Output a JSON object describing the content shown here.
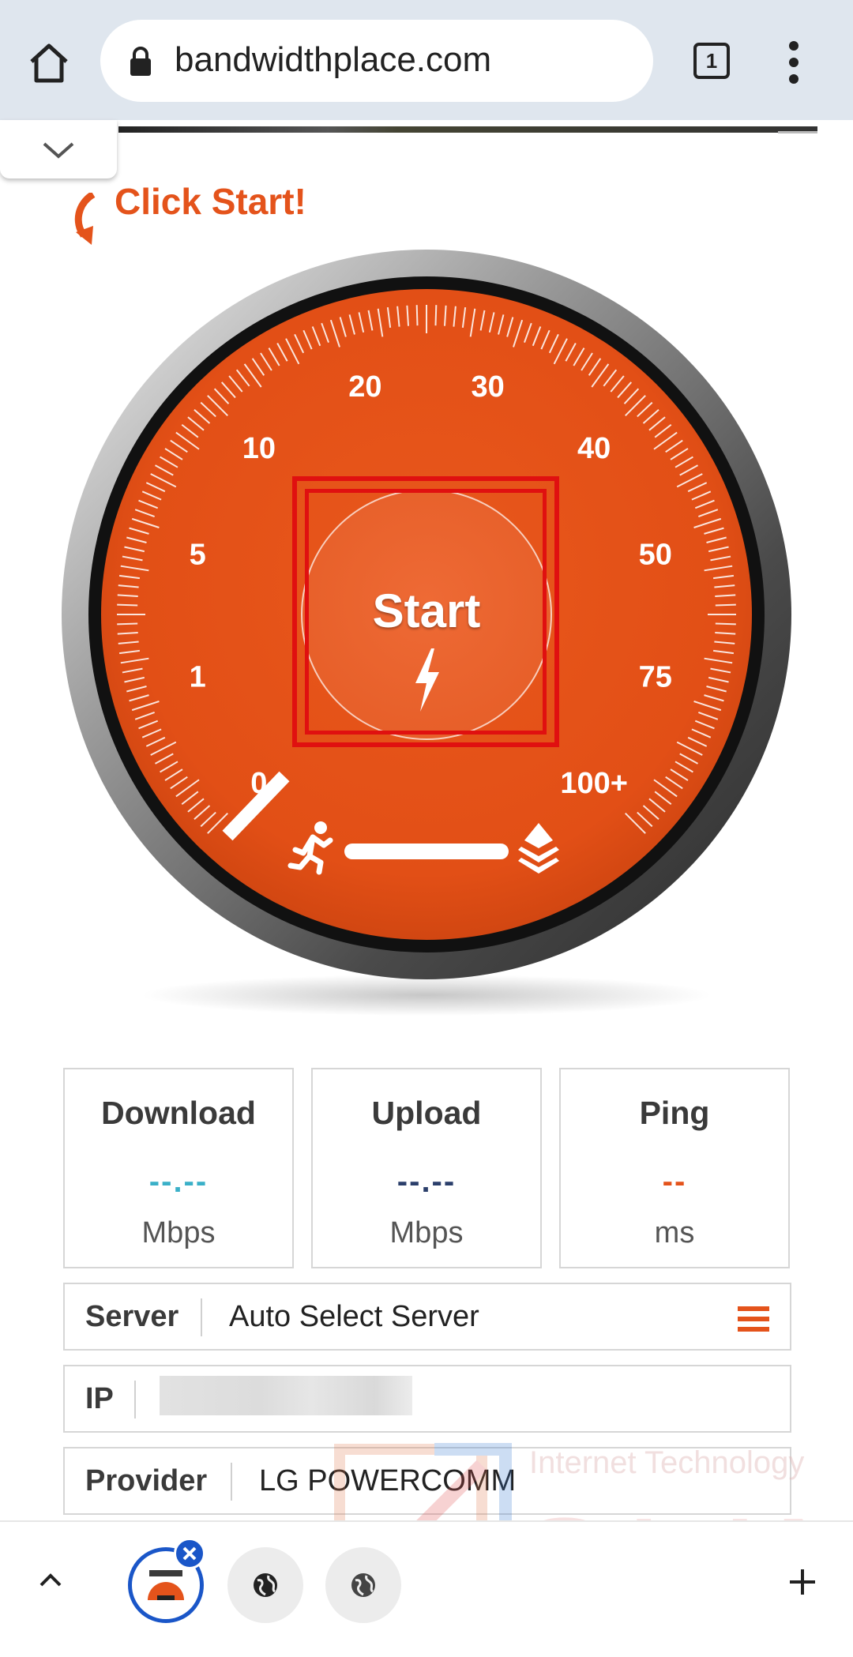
{
  "browser": {
    "url": "bandwidthplace.com",
    "tab_count": "1"
  },
  "page": {
    "click_start": "Click Start!",
    "start_label": "Start"
  },
  "gauge": {
    "scale_labels": [
      "0",
      "1",
      "5",
      "10",
      "20",
      "30",
      "40",
      "50",
      "75",
      "100+"
    ]
  },
  "results": {
    "download": {
      "title": "Download",
      "value": "--.--",
      "unit": "Mbps",
      "color": "#3ab0c8"
    },
    "upload": {
      "title": "Upload",
      "value": "--.--",
      "unit": "Mbps",
      "color": "#2b3f6b"
    },
    "ping": {
      "title": "Ping",
      "value": "--",
      "unit": "ms",
      "color": "#e4531b"
    }
  },
  "info": {
    "server_label": "Server",
    "server_value": "Auto Select Server",
    "ip_label": "IP",
    "provider_label": "Provider",
    "provider_value": "LG POWERCOMM"
  },
  "watermark": {
    "line1": "Internet Technology",
    "line2": "SLIM"
  },
  "colors": {
    "accent": "#e4531b",
    "tab_blue": "#1a56c8"
  }
}
